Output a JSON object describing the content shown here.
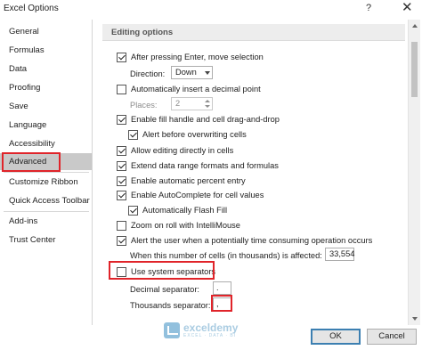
{
  "window": {
    "title": "Excel Options",
    "help_glyph": "?",
    "close_glyph": "✕"
  },
  "nav": {
    "items": [
      {
        "label": "General"
      },
      {
        "label": "Formulas"
      },
      {
        "label": "Data"
      },
      {
        "label": "Proofing"
      },
      {
        "label": "Save"
      },
      {
        "label": "Language"
      },
      {
        "label": "Accessibility"
      },
      {
        "label": "Advanced",
        "selected": true
      },
      {
        "label": "Customize Ribbon"
      },
      {
        "label": "Quick Access Toolbar"
      },
      {
        "label": "Add-ins"
      },
      {
        "label": "Trust Center"
      }
    ]
  },
  "section": {
    "title": "Editing options"
  },
  "options": {
    "after_enter": {
      "label": "After pressing Enter, move selection",
      "checked": true
    },
    "direction": {
      "label": "Direction:",
      "value": "Down"
    },
    "auto_decimal": {
      "label": "Automatically insert a decimal point",
      "checked": false
    },
    "places": {
      "label": "Places:",
      "value": "2"
    },
    "fill_handle": {
      "label": "Enable fill handle and cell drag-and-drop",
      "checked": true
    },
    "alert_overwrite": {
      "label": "Alert before overwriting cells",
      "checked": true
    },
    "edit_in_cells": {
      "label": "Allow editing directly in cells",
      "checked": true
    },
    "extend_formats": {
      "label": "Extend data range formats and formulas",
      "checked": true
    },
    "auto_percent": {
      "label": "Enable automatic percent entry",
      "checked": true
    },
    "autocomplete": {
      "label": "Enable AutoComplete for cell values",
      "checked": true
    },
    "flash_fill": {
      "label": "Automatically Flash Fill",
      "checked": true
    },
    "zoom_intellimouse": {
      "label": "Zoom on roll with IntelliMouse",
      "checked": false
    },
    "alert_time": {
      "label": "Alert the user when a potentially time consuming operation occurs",
      "checked": true
    },
    "cells_affected": {
      "label": "When this number of cells (in thousands) is affected:",
      "value": "33,554"
    },
    "system_separators": {
      "label": "Use system separators",
      "checked": false
    },
    "decimal_separator": {
      "label": "Decimal separator:",
      "value": "."
    },
    "thousands_separator": {
      "label": "Thousands separator:",
      "value": ","
    }
  },
  "watermark": {
    "name": "exceldemy",
    "tagline": "EXCEL · DATA · BI"
  },
  "buttons": {
    "ok": "OK",
    "cancel": "Cancel"
  },
  "colors": {
    "highlight_red": "#e0242a",
    "selected_nav": "#c9c9c9",
    "default_button_border": "#3c7fb1"
  }
}
